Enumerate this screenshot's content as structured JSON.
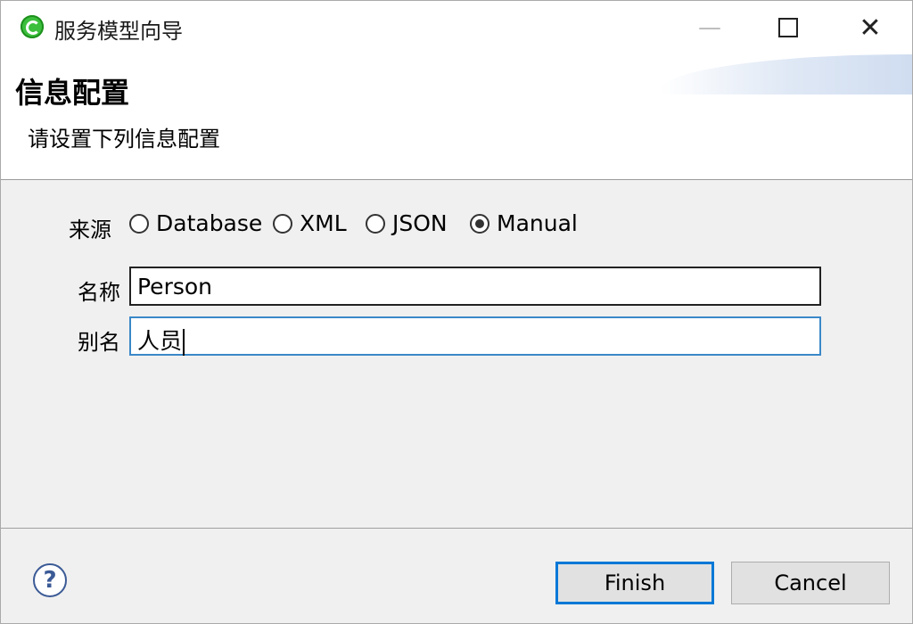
{
  "window": {
    "title": "服务模型向导",
    "controls": {
      "minimize": "—",
      "maximize": "",
      "close": "✕"
    }
  },
  "banner": {
    "heading": "信息配置",
    "description": "请设置下列信息配置"
  },
  "form": {
    "source_label": "来源",
    "source_options": [
      {
        "label": "Database",
        "checked": false
      },
      {
        "label": "XML",
        "checked": false
      },
      {
        "label": "JSON",
        "checked": false
      },
      {
        "label": "Manual",
        "checked": true
      }
    ],
    "name_label": "名称",
    "name_value": "Person",
    "alias_label": "别名",
    "alias_value": "人员"
  },
  "footer": {
    "help_icon": "?",
    "finish_label": "Finish",
    "cancel_label": "Cancel"
  },
  "colors": {
    "focus_border": "#3a88c8",
    "default_button_border": "#0078d7",
    "app_icon": "#3cbf3c"
  }
}
